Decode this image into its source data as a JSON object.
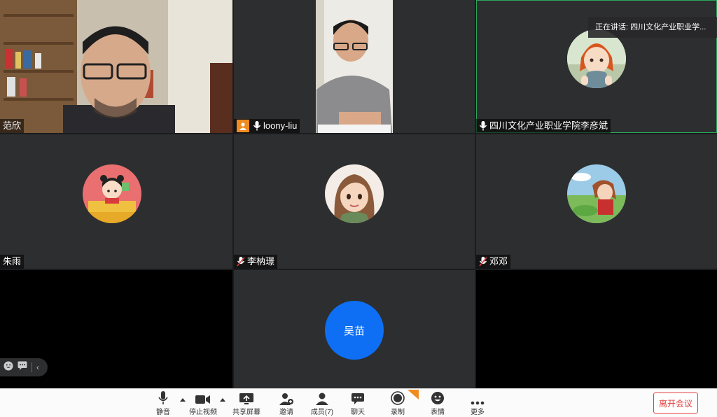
{
  "speaking_now": "正在讲话: 四川文化产业职业学...",
  "participants": [
    {
      "name": "范欣",
      "video": true
    },
    {
      "name": "loony-liu",
      "video": true,
      "host": true
    },
    {
      "name": "四川文化产业职业学院李彦斌",
      "video": false
    },
    {
      "name": "朱雨",
      "video": false
    },
    {
      "name": "李枘璟",
      "video": false,
      "muted": true
    },
    {
      "name": "邓邓",
      "video": false,
      "muted": true
    },
    {
      "name": "",
      "video": false
    },
    {
      "name": "吴苗",
      "video": false,
      "avatar_text": "吴苗"
    },
    {
      "name": "",
      "video": false
    }
  ],
  "toolbar": {
    "mute": "静音",
    "stop_video": "停止视频",
    "share_screen": "共享屏幕",
    "invite": "邀请",
    "members": "成员(7)",
    "chat": "聊天",
    "record": "录制",
    "reactions": "表情",
    "more": "更多",
    "leave": "离开会议"
  },
  "colors": {
    "accent_blue": "#0e6ff5",
    "leave_red": "#e23c3c",
    "host_orange": "#f08b22",
    "speaking_green": "#2aa65a"
  }
}
